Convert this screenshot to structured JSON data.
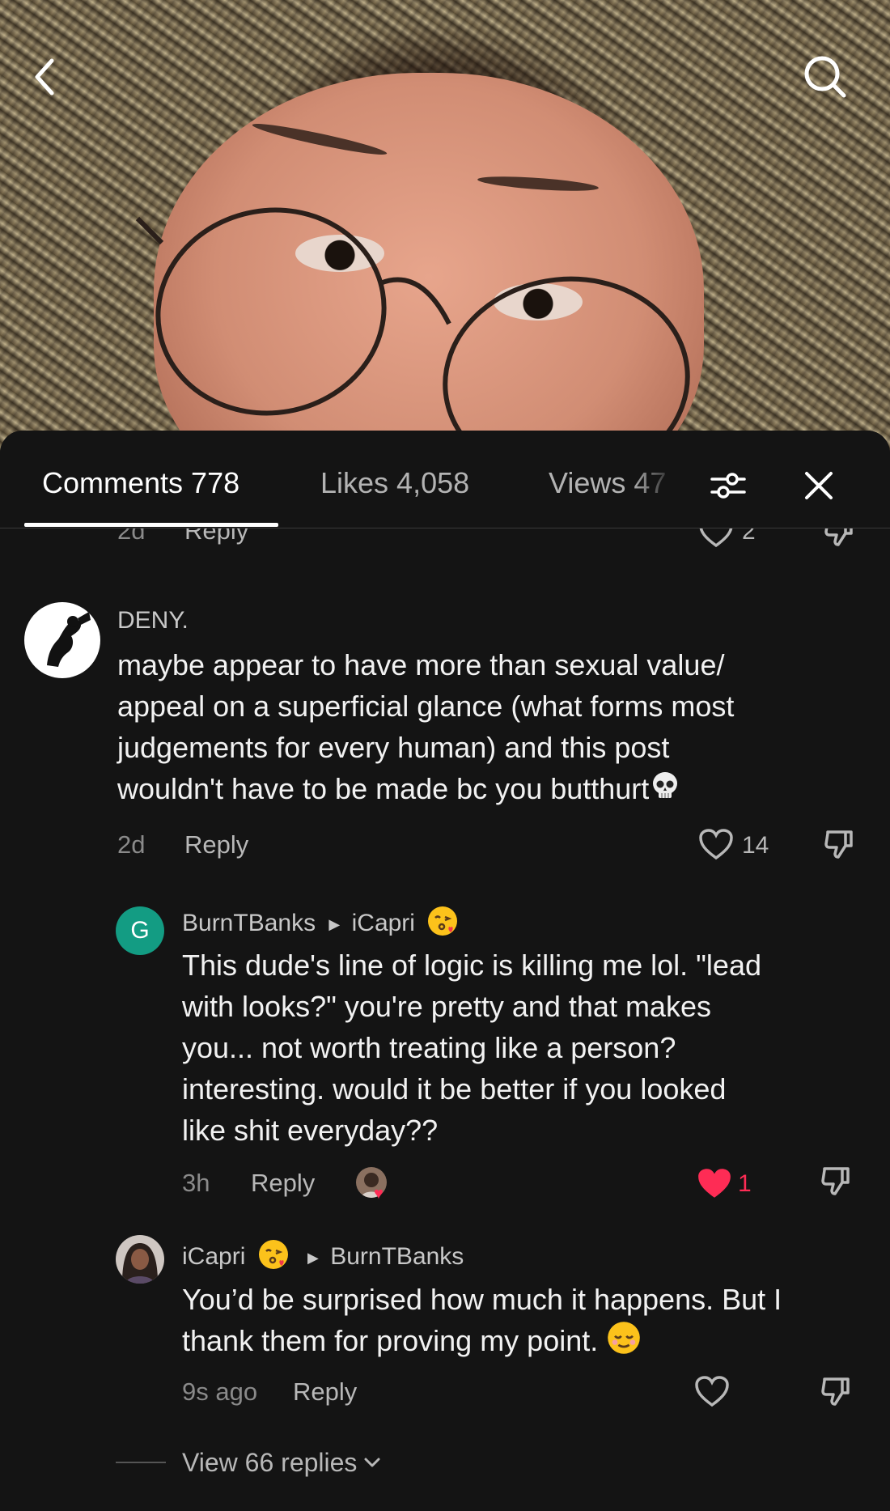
{
  "colors": {
    "background": "#141414",
    "like_active": "#fe2c55",
    "avatar_g": "#139c83"
  },
  "nav": {
    "back_icon": "chevron-left-icon",
    "search_icon": "search-icon"
  },
  "tabs": {
    "comments": "Comments 778",
    "likes": "Likes 4,058",
    "views": "Views 47",
    "filter_icon": "sliders-icon",
    "close_icon": "close-icon"
  },
  "partial_comment": {
    "time": "2d",
    "reply": "Reply",
    "likes": "2"
  },
  "comments": [
    {
      "author": "DENY.",
      "lines": [
        "maybe appear to have more than sexual value/",
        "appeal on a superficial glance (what forms most",
        "judgements for every human) and this post",
        "wouldn't have to be made bc you butthurt"
      ],
      "emoji": "skull-emoji",
      "time": "2d",
      "reply": "Reply",
      "likes": "14"
    },
    {
      "author": "BurnTBanks",
      "avatar_letter": "G",
      "reply_to": "iCapri",
      "lines": [
        "This dude's line of logic is killing me lol. \"lead",
        "with looks?\" you're pretty and that makes",
        "you... not worth treating like a person?",
        "interesting. would it be better if you looked",
        "like shit everyday??"
      ],
      "time": "3h",
      "reply": "Reply",
      "likes": "1"
    },
    {
      "author": "iCapri",
      "reply_to": "BurnTBanks",
      "lines": [
        "You’d be surprised how much it happens. But I",
        "thank them for proving my point."
      ],
      "time": "9s ago",
      "reply": "Reply",
      "likes": ""
    }
  ],
  "view_replies": "View 66 replies"
}
